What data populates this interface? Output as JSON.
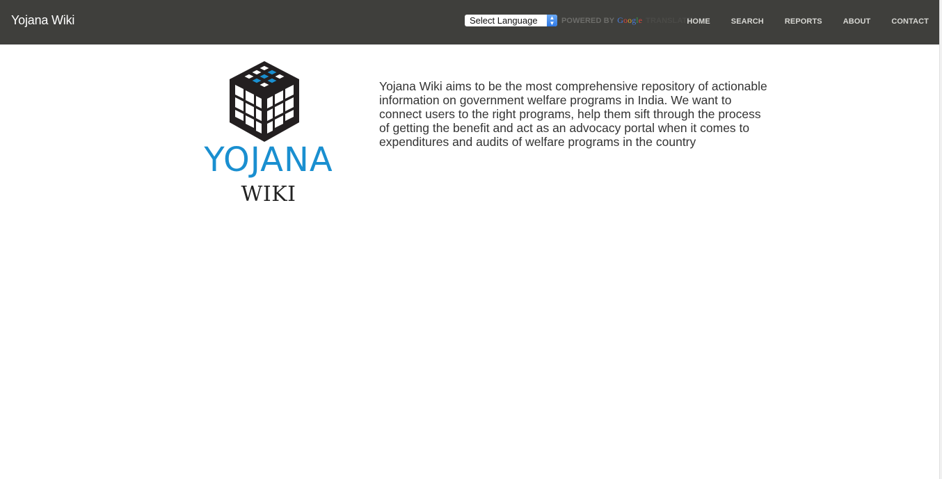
{
  "header": {
    "brand": "Yojana Wiki",
    "language_select": {
      "selected": "Select Language"
    },
    "powered_by": "POWERED BY",
    "google": [
      "G",
      "o",
      "o",
      "g",
      "l",
      "e"
    ],
    "translate": "TRANSLATE",
    "nav": [
      "HOME",
      "SEARCH",
      "REPORTS",
      "ABOUT",
      "CONTACT"
    ]
  },
  "main": {
    "logo": {
      "title": "YOJANA",
      "subtitle": "WIKI"
    },
    "intro": "Yojana Wiki aims to be the most comprehensive repository of actionable information on government welfare programs in India. We want to connect users to the right programs, help them sift through the process of getting the benefit and act as an advocacy portal when it comes to expenditures and audits of welfare programs in the country"
  },
  "colors": {
    "header_bg": "#3f3f3c",
    "logo_blue": "#1a8fd0",
    "logo_dark": "#222222"
  },
  "icons": {
    "select_arrow": "chevron-up-down-icon"
  }
}
